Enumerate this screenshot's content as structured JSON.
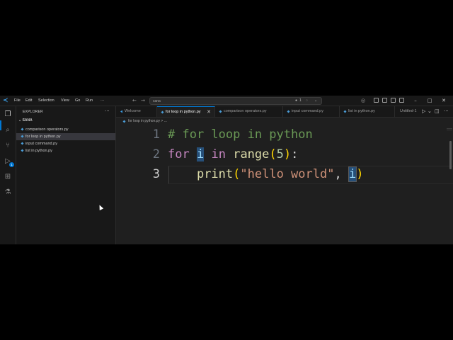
{
  "titlebar": {
    "menu": [
      "File",
      "Edit",
      "Selection",
      "View",
      "Go",
      "Run",
      "···"
    ],
    "search_value": "sana",
    "copilot_count": "1"
  },
  "sidebar": {
    "title": "EXPLORER",
    "folder": "SANA",
    "files": [
      {
        "name": "comparison operators.py",
        "selected": false
      },
      {
        "name": "for loop in python.py",
        "selected": true
      },
      {
        "name": "input command.py",
        "selected": false
      },
      {
        "name": "list in python.py",
        "selected": false
      }
    ],
    "source_control_badge": "1"
  },
  "tabs": [
    {
      "label": "Welcome",
      "active": false
    },
    {
      "label": "for loop in python.py",
      "active": true
    },
    {
      "label": "comparison operators.py",
      "active": false
    },
    {
      "label": "input command.py",
      "active": false
    },
    {
      "label": "list in python.py",
      "active": false
    },
    {
      "label": "Untitled-1",
      "active": false
    }
  ],
  "breadcrumb": "for loop in python.py > ...",
  "editor": {
    "line_numbers": [
      "1",
      "2",
      "3"
    ],
    "line1": {
      "comment": "# for loop in python"
    },
    "line2": {
      "kw1": "for",
      "var": "i",
      "kw2": "in",
      "fn": "range",
      "p_open": "(",
      "num": "5",
      "p_close": ")",
      "colon": ":"
    },
    "line3": {
      "indent": "    ",
      "fn": "print",
      "p_open": "(",
      "str": "\"hello world\"",
      "comma": ", ",
      "var": "i",
      "p_close": ")"
    }
  },
  "colors": {
    "accent": "#0078d4",
    "python_icon": "#4a9cd6"
  }
}
